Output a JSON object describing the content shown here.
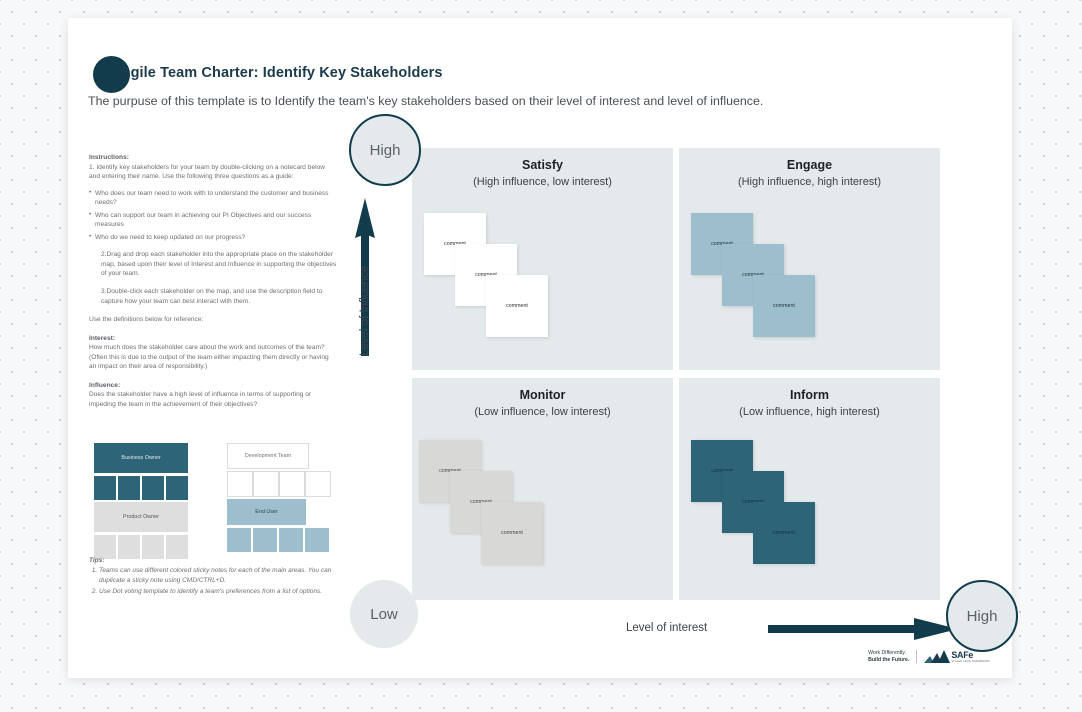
{
  "header": {
    "title": "Agile Team Charter: Identify Key Stakeholders",
    "subtitle": "The purpuse of this template is to Identify the team's key stakeholders based on their level of interest and level of influence."
  },
  "instructions": {
    "heading": "Instructions:",
    "step1": "1. Identify key stakeholders for your team by double-clicking on a notecard  below and entering their name. Use the following three questions as a guide:",
    "questions": [
      "Who does our team need to work with to understand the customer and business needs?",
      "Who can support our team in achieving our PI Objectives and our success measures",
      "Who do we need to keep updated on our progress?"
    ],
    "step2": "2.Drag and drop each stakeholder into the appropriate place on the stakeholder map, based upon their level of Interest and Influence in supporting the objectives of your team.",
    "step3": "3.Double-click each stakeholder on the map, and use the description field to capture how your team can best interact with them.",
    "definitions_intro": "Use the definitions below for reference:",
    "interest_head": "Interest:",
    "interest_body": "How much does the stakeholder care about the work and outcomes of the team?",
    "interest_note": "(Often this is due to the output of the team either impacting them directly or having an impact on their area of responsibility.)",
    "influence_head": "Influence:",
    "influence_body": "Does the stakeholder have a high level of influence in terms of supporting or impeding the team in the achievement of their objectives?"
  },
  "tips": {
    "heading": "Tips:",
    "items": [
      "Teams can use different colored sticky notes for each of the main areas. You can duplicate a sticky note using CMD/CTRL+D.",
      "Use Dot voting template to identify a team's preferences from a list of options."
    ]
  },
  "palette": {
    "business_owner": "Business Owner",
    "product_owner": "Product Owner",
    "development_team": "Development Team",
    "end_user": "End User",
    "colors": {
      "dark_teal": "#2e6478",
      "grey": "#dedede",
      "white": "#ffffff",
      "light_blue": "#9dbecd"
    }
  },
  "matrix": {
    "quadrants": [
      {
        "title": "Satisfy",
        "subtitle": "(High influence, low interest)",
        "note_style": "white",
        "note_label": "comment"
      },
      {
        "title": "Engage",
        "subtitle": "(High influence, high interest)",
        "note_style": "blue",
        "note_label": "comment"
      },
      {
        "title": "Monitor",
        "subtitle": "(Low influence, low interest)",
        "note_style": "grey",
        "note_label": "comment"
      },
      {
        "title": "Inform",
        "subtitle": "(Low influence, high interest)",
        "note_style": "dark",
        "note_label": "comment"
      }
    ],
    "axis_y_label": "Level of Influence",
    "axis_x_label": "Level of interest",
    "y_high": "High",
    "y_low": "Low",
    "x_high": "High",
    "accent_color": "#123c4c",
    "quadrant_bg": "#e4e9ec"
  },
  "footer": {
    "tagline_line1": "Work Differently.",
    "tagline_line2": "Build the Future.",
    "brand": "SAFe",
    "brand_sub": "SCALED AGILE FRAMEWORK"
  }
}
